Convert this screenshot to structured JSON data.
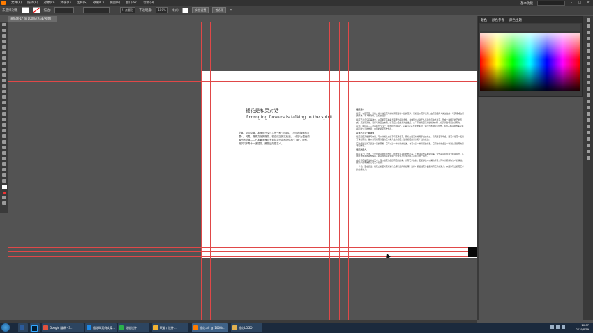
{
  "menubar": {
    "items": [
      "文件(F)",
      "编辑(E)",
      "对象(O)",
      "文字(T)",
      "选择(S)",
      "效果(C)",
      "视图(V)",
      "窗口(W)",
      "帮助(H)"
    ],
    "workspace": "基本功能",
    "window_controls": [
      "–",
      "□",
      "×"
    ]
  },
  "controlbar": {
    "selection": "未选择对象",
    "stroke_label": "描边:",
    "brush": "5 点圆形",
    "opacity_label": "不透明度:",
    "opacity": "100%",
    "style_label": "样式:",
    "doc_setup": "文档设置",
    "prefs": "首选项"
  },
  "document_tab": "未标题-1* @ 100% (RGB/预览)",
  "artboard": {
    "heading_cn": "插花是和灵对话",
    "heading_en": "Arranging flowers is talking to the spirit",
    "body_cn": "花道，又叫华道，本来是日文汉字的一种\"小插件\"（小小的插瓶的意思），可是，随着文化的瓶花，很自成流的文化道。人们多为插画的源出言花道——日本最清雅且大到插华兴花瓶提供的\"门派\"，帮别，用次又半帮十一道插花，最能还改是艺术。",
    "right_col": [
      "插花简介",
      "插花，也称花艺，是指：将人体与花草的协调结合到一起的艺术，它们是以花草表现，由来已经知人类过往的人与其组成之间的具体，有人种对象，美好的展示。",
      "插花艺术与空间是融合，以花和花卉的美为需要的基础条件，并体现出人对于人与自然与中外对花，形成一种特定的艺术形式，来达到美化、装饰与欣赏之效果。插花应以自然美为出发点，从不同的角度来组合植物材料，使其具备特定的表现力。",
      "花道，即插花——日本称为\"花道\"，中国称为\"插花\"，它是以花卉为主要素材，通过艺术构思与创作，表达人们心中的美好情感和对生活的热爱，中国的插花历史悠久。",
      "花道艺术之一种流派",
      "插花按照其性质与作用，可以分成礼仪插花与艺术插花，而礼仪插花常常用于社交礼仪、喜庆婚丧等场合，而艺术插花一般用于美化环境，是以表现插花作品的艺术美为主的插花，注重插花的意境和个性的表达。",
      "它的用途是为了表达一定的思想，它可以是一种对景的描述，也可以是一种情感的抒发，它有时候也会是一种对生活哲理的思考和体验。",
      "插花欣赏大，",
      "插花是一门艺术，它要求插花者在创作时，既要注意花材的外形美，又要注意作品的意境美，使作品具有生命力和感染力，从而表达作者的思想情感，插花在当今社会中已经成为人们生活中不可缺少的一部分。",
      "由于插花是有生命的艺术，所以插花作品既有自然的美，也有艺术的美，它能够给人以美的享受，同时也能够陶冶人的情操，提高人的审美能力和艺术修养。",
      "一个插，要在适当，插花之前要对花材进行合理的选择和处理，这样才能使插花作品更具有艺术感染力，从而体现出插花艺术的独特魅力。"
    ]
  },
  "color_panel": {
    "tabs": [
      "颜色",
      "颜色参考",
      "颜色主题"
    ]
  },
  "taskbar": {
    "tasks": [
      {
        "label": "",
        "color": "#2c5b9a"
      },
      {
        "label": "",
        "color": "#001d34"
      },
      {
        "label": "Google 翻译 - 3...",
        "color": "#e2523e"
      },
      {
        "label": "插花ID案例文案...",
        "color": "#1e88e5"
      },
      {
        "label": "花道设计",
        "color": "#2bb24c"
      },
      {
        "label": "天猫 / 设计...",
        "color": "#f2b233"
      },
      {
        "label": "插花.ai* @ 100%...",
        "color": "#ff7c00"
      },
      {
        "label": "插花LOGO",
        "color": "#e0b050"
      }
    ],
    "time": "20:07",
    "date": "2019/8/19"
  }
}
